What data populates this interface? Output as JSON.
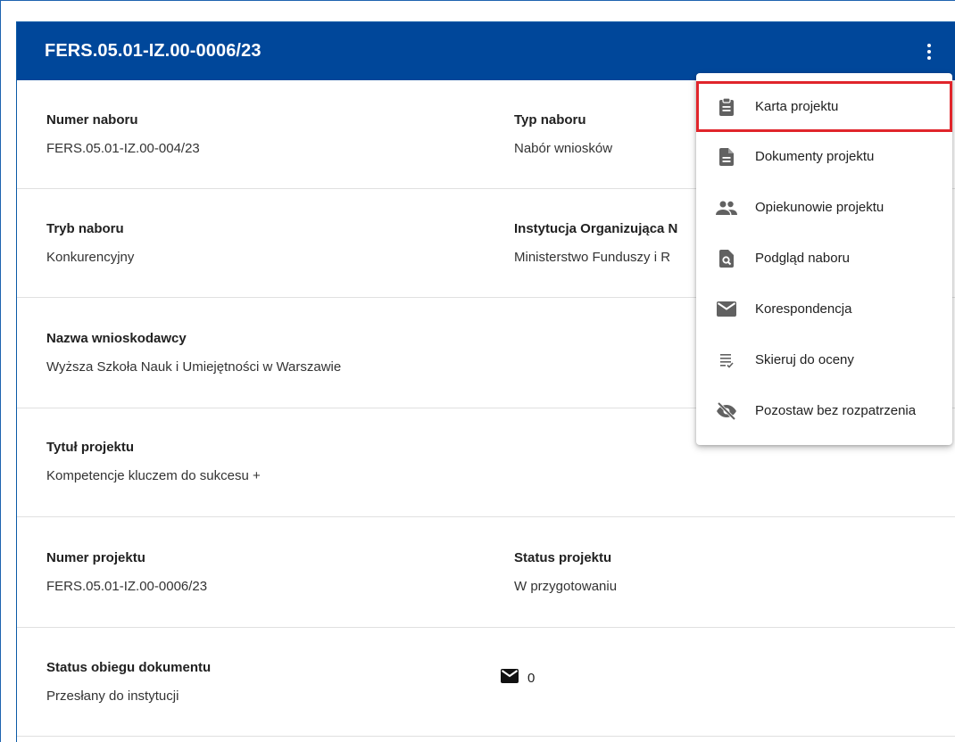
{
  "header": {
    "title": "FERS.05.01-IZ.00-0006/23",
    "menu_icon": "more-vert-icon"
  },
  "fields": {
    "numer_naboru": {
      "label": "Numer naboru",
      "value": "FERS.05.01-IZ.00-004/23"
    },
    "typ_naboru": {
      "label": "Typ naboru",
      "value": "Nabór wniosków"
    },
    "tryb_naboru": {
      "label": "Tryb naboru",
      "value": "Konkurencyjny"
    },
    "instytucja": {
      "label": "Instytucja Organizująca N",
      "value": "Ministerstwo Funduszy i R"
    },
    "nazwa_wnioskodawcy": {
      "label": "Nazwa wnioskodawcy",
      "value": "Wyższa Szkoła Nauk i Umiejętności w Warszawie"
    },
    "tytul_projektu": {
      "label": "Tytuł projektu",
      "value": "Kompetencje kluczem do sukcesu +"
    },
    "numer_projektu": {
      "label": "Numer projektu",
      "value": "FERS.05.01-IZ.00-0006/23"
    },
    "status_projektu": {
      "label": "Status projektu",
      "value": "W przygotowaniu"
    },
    "status_obiegu": {
      "label": "Status obiegu dokumentu",
      "value": "Przesłany do instytucji"
    },
    "correspondence_count": "0"
  },
  "menu": {
    "items": [
      {
        "label": "Karta projektu",
        "icon": "clipboard-icon",
        "highlighted": true
      },
      {
        "label": "Dokumenty projektu",
        "icon": "document-icon"
      },
      {
        "label": "Opiekunowie projektu",
        "icon": "people-icon"
      },
      {
        "label": "Podgląd naboru",
        "icon": "document-search-icon"
      },
      {
        "label": "Korespondencja",
        "icon": "mail-icon"
      },
      {
        "label": "Skieruj do oceny",
        "icon": "checklist-icon"
      },
      {
        "label": "Pozostaw bez rozpatrzenia",
        "icon": "visibility-off-icon"
      }
    ]
  },
  "colors": {
    "header_bg": "#00479a",
    "highlight": "#e0252b",
    "icon": "#616161"
  }
}
